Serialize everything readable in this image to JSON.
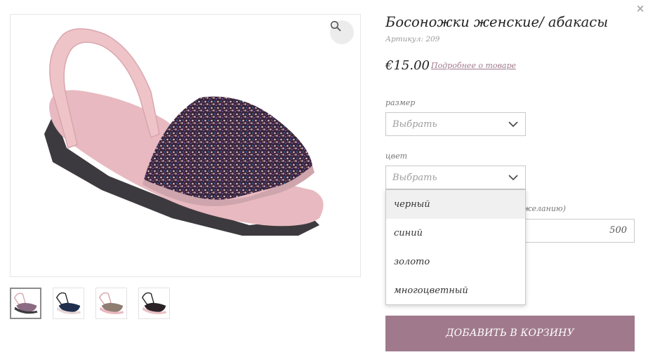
{
  "modal": {
    "close_glyph": "×"
  },
  "product": {
    "title": "Босоножки женские/ абакасы",
    "sku": "Артикул: 209",
    "price": "€15.00",
    "details_link": "Подробнее о товаре"
  },
  "gallery": {
    "zoom_icon": "magnifier-icon",
    "thumbnails": [
      {
        "name": "pink-glitter",
        "color": "#8a6b82"
      },
      {
        "name": "navy-glitter",
        "color": "#1f2f4d"
      },
      {
        "name": "bronze-glitter",
        "color": "#8f7d72"
      },
      {
        "name": "black-glitter",
        "color": "#2a2226"
      }
    ],
    "active_index": 0
  },
  "options": {
    "size": {
      "label": "размер",
      "value": "Выбрать"
    },
    "color": {
      "label": "цвет",
      "value": "Выбрать",
      "items": [
        "черный",
        "синий",
        "золото",
        "многоцветный"
      ],
      "highlighted_index": 0
    },
    "partial_label": "желанию)",
    "quantity_value": "500"
  },
  "add_to_cart": "ДОБАВИТЬ В КОРЗИНУ",
  "colors": {
    "accent": "#a07a8c",
    "border": "#c9c9c9"
  }
}
